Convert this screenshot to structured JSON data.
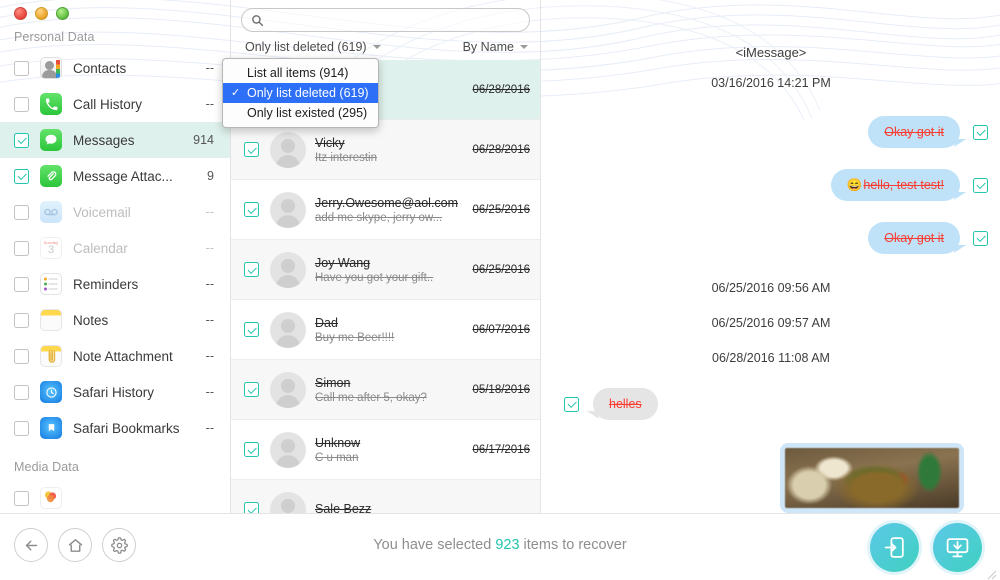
{
  "window": {
    "traffic_lights": [
      "close",
      "minimize",
      "maximize"
    ]
  },
  "sidebar": {
    "groups": [
      {
        "title": "Personal Data",
        "items": [
          {
            "label": "Contacts",
            "count": "--",
            "icon": "contacts-icon",
            "checked": false,
            "dim": false,
            "selected": false
          },
          {
            "label": "Call History",
            "count": "--",
            "icon": "call-history-icon",
            "checked": false,
            "dim": false,
            "selected": false
          },
          {
            "label": "Messages",
            "count": "914",
            "icon": "messages-icon",
            "checked": true,
            "dim": false,
            "selected": true
          },
          {
            "label": "Message Attac...",
            "count": "9",
            "icon": "message-attachment-icon",
            "checked": true,
            "dim": false,
            "selected": false
          },
          {
            "label": "Voicemail",
            "count": "--",
            "icon": "voicemail-icon",
            "checked": false,
            "dim": true,
            "selected": false
          },
          {
            "label": "Calendar",
            "count": "--",
            "icon": "calendar-icon",
            "checked": false,
            "dim": true,
            "selected": false
          },
          {
            "label": "Reminders",
            "count": "--",
            "icon": "reminders-icon",
            "checked": false,
            "dim": false,
            "selected": false
          },
          {
            "label": "Notes",
            "count": "--",
            "icon": "notes-icon",
            "checked": false,
            "dim": false,
            "selected": false
          },
          {
            "label": "Note Attachment",
            "count": "--",
            "icon": "note-attachment-icon",
            "checked": false,
            "dim": false,
            "selected": false
          },
          {
            "label": "Safari History",
            "count": "--",
            "icon": "safari-history-icon",
            "checked": false,
            "dim": false,
            "selected": false
          },
          {
            "label": "Safari Bookmarks",
            "count": "--",
            "icon": "safari-bookmarks-icon",
            "checked": false,
            "dim": false,
            "selected": false
          }
        ]
      },
      {
        "title": "Media Data",
        "items": [
          {
            "label": "",
            "count": "",
            "icon": "photos-icon",
            "checked": false,
            "dim": false,
            "selected": false
          }
        ]
      }
    ]
  },
  "list_panel": {
    "search": {
      "value": "",
      "placeholder": ""
    },
    "filter": {
      "selected_label": "Only list deleted (619)"
    },
    "sort": {
      "selected_label": "By Name"
    },
    "dropdown": {
      "open": true,
      "items": [
        {
          "label": "List all items (914)",
          "checked": false
        },
        {
          "label": "Only list deleted (619)",
          "checked": true
        },
        {
          "label": "Only list existed (295)",
          "checked": false
        }
      ],
      "check_glyph": "✓"
    },
    "rows": [
      {
        "name": "",
        "snippet": "",
        "date": "06/28/2016",
        "checked": true,
        "selected": true
      },
      {
        "name": "Vicky",
        "snippet": "Itz interestin",
        "date": "06/28/2016",
        "checked": true,
        "selected": false
      },
      {
        "name": "Jerry.Owesome@aol.com",
        "snippet": "add me skype, jerry ow...",
        "date": "06/25/2016",
        "checked": true,
        "selected": false
      },
      {
        "name": "Joy Wang",
        "snippet": "Have you got your gift..",
        "date": "06/25/2016",
        "checked": true,
        "selected": false
      },
      {
        "name": "Dad",
        "snippet": "Buy me Beer!!!!",
        "date": "06/07/2016",
        "checked": true,
        "selected": false
      },
      {
        "name": "Simon",
        "snippet": "Call me after 5, okay?",
        "date": "05/18/2016",
        "checked": true,
        "selected": false
      },
      {
        "name": "Unknow",
        "snippet": "C u man",
        "date": "06/17/2016",
        "checked": true,
        "selected": false
      },
      {
        "name": "Sale Bezz",
        "snippet": "",
        "date": "",
        "checked": true,
        "selected": false
      }
    ]
  },
  "chat_panel": {
    "title": "<iMessage>",
    "entries": [
      {
        "kind": "timestamp",
        "text": "03/16/2016 14:21 PM"
      },
      {
        "kind": "bubble",
        "side": "out",
        "style": "blue",
        "text": "Okay got it",
        "emoji": "",
        "checked": true
      },
      {
        "kind": "bubble",
        "side": "out",
        "style": "blue",
        "text": "hello, test test!",
        "emoji": "😄",
        "checked": true
      },
      {
        "kind": "bubble",
        "side": "out",
        "style": "blue",
        "text": "Okay got it",
        "emoji": "",
        "checked": true
      },
      {
        "kind": "timestamp",
        "text": "06/25/2016 09:56 AM"
      },
      {
        "kind": "timestamp",
        "text": "06/25/2016 09:57 AM"
      },
      {
        "kind": "timestamp",
        "text": "06/28/2016 11:08 AM"
      },
      {
        "kind": "bubble",
        "side": "in",
        "style": "gray",
        "text": "helles",
        "emoji": "",
        "checked": true
      },
      {
        "kind": "photo",
        "side": "out",
        "alt": "food-photo-attachment"
      }
    ]
  },
  "bottom_bar": {
    "back_label": "back",
    "home_label": "home",
    "settings_label": "settings",
    "status_prefix": "You have selected",
    "status_count": "923",
    "status_suffix": "items to recover",
    "recover_to_device_label": "Recover to Device",
    "recover_to_computer_label": "Recover to Computer"
  },
  "colors": {
    "accent_teal": "#24c6ae",
    "selection_row": "#dff1ec",
    "menu_highlight": "#2d6ff7",
    "bubble_blue": "#bfe2f8",
    "bubble_gray": "#e5e5e5",
    "deleted_text_red": "#fb3b2e",
    "action_gradient_start": "#5cc8e8",
    "action_gradient_end": "#3fd1c0"
  }
}
